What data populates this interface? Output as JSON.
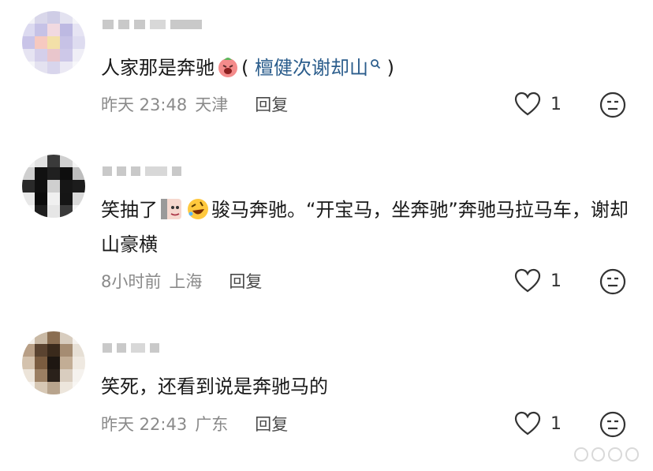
{
  "comments": [
    {
      "text_before": "人家那是奔驰",
      "link_open": "( ",
      "link": "檀健次谢却山",
      "link_close": " )",
      "time": "昨天 23:48",
      "location": "天津",
      "reply": "回复",
      "likes": "1",
      "emoji_1": "laughing-peach-emoji"
    },
    {
      "text_before": "笑抽了",
      "text_after": "骏马奔驰。“开宝马，坐奔驰”奔驰马拉马车，谢却山豪横",
      "time": "8小时前",
      "location": "上海",
      "reply": "回复",
      "likes": "1",
      "emoji_1": "sticker-emoji",
      "emoji_2": "rolling-laugh-emoji"
    },
    {
      "text": "笑死，还看到说是奔驰马的",
      "time": "昨天 22:43",
      "location": "广东",
      "reply": "回复",
      "likes": "1"
    }
  ],
  "icons": {
    "like": "heart-outline-icon",
    "more": "neutral-face-icon",
    "search": "search-icon"
  },
  "colors": {
    "link": "#2b5d8c",
    "meta": "#8a8a8a",
    "text": "#1a1a1a"
  }
}
